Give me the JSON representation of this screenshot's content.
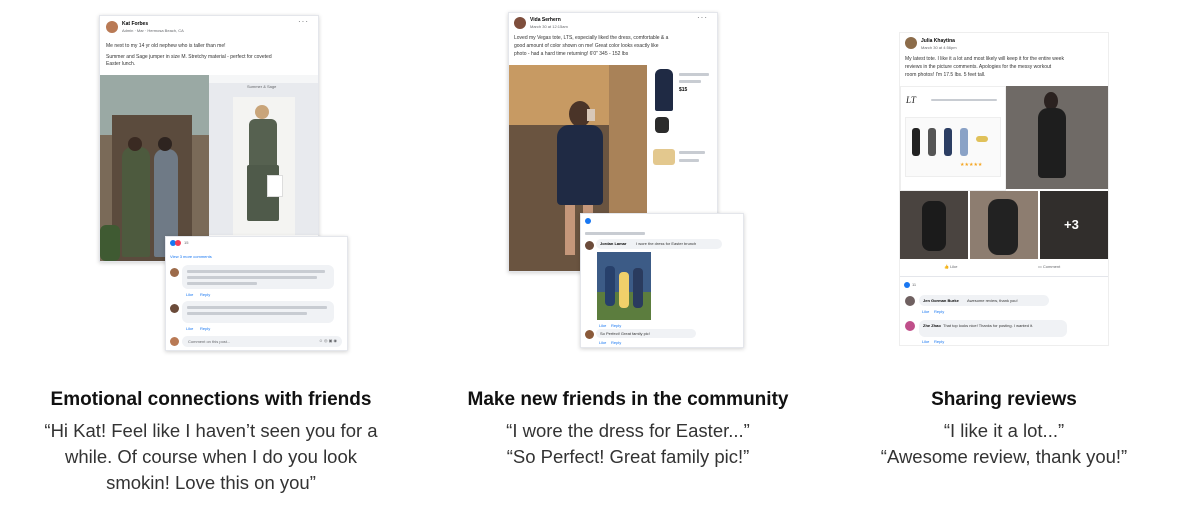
{
  "panels": [
    {
      "heading": "Emotional connections with friends",
      "quote_lines": [
        "“Hi Kat! Feel like I haven’t seen you for a",
        "while. Of course when I do you look",
        "smokin! Love this on you”"
      ],
      "post": {
        "author": "Kat Forbes",
        "meta": "Admin · Mar · Hermosa Beach, CA",
        "text_lines": [
          "Me next to my 14 yr old nephew who is taller than me!",
          "Summer and Sage jumper in size M. Stretchy material - perfect for coveted",
          "Easter lunch."
        ],
        "product_title": "Summer & Sage",
        "reaction_count": "15",
        "view_comments": "View 3 more comments",
        "comment_box_placeholder": "Comment on this post...",
        "like": "Like",
        "reply": "Reply",
        "comment_age": "1w"
      },
      "colors": {
        "avatar": "#b97a55",
        "photo_bg": "#7a6a58",
        "product_bg": "#e8eaee"
      }
    },
    {
      "heading": "Make new friends in the community",
      "quote_lines": [
        "“I wore the dress for Easter...”",
        "“So Perfect! Great family pic!”"
      ],
      "post": {
        "author": "Vida Serhern",
        "meta": "March 30 at 12:15am",
        "text_lines": [
          "Loved my Vegas tote, LTS, especially liked the dress, comfortable & a",
          "good amount of color shown on me! Great color looks exactly like",
          "photo - had a hard time returning! 6'0\" 345 - 152 lbs"
        ],
        "price": "$15",
        "comment1_author": "Jordan Lamar",
        "comment1": "I wore the dress for Easter brunch",
        "comment2": "So Perfect! Great family pic!",
        "like": "Like",
        "reply": "Reply"
      },
      "colors": {
        "avatar": "#7e4e3c",
        "photo_bg": "#8a6a48",
        "dress": "#1f2a44"
      }
    },
    {
      "heading": "Sharing reviews",
      "quote_lines": [
        "“I like it a lot...”",
        "“Awesome review, thank you!”"
      ],
      "post": {
        "author": "Julia Khaytina",
        "meta": "March 30 at 4:56pm",
        "text_lines": [
          "My latest tote. I like it a lot and most likely will keep it for the entire week",
          "reviews in the picture comments. Apologies for the messy workout",
          "room photos! I'm 17.5 lbs. 5 feet tall."
        ],
        "logo": "LT",
        "more_photos": "+3",
        "like_button": "Like",
        "comment_button": "Comment",
        "reaction_count": "11",
        "comment1_author": "Jen Gorman Burke",
        "comment1": "Awesome review, thank you!",
        "comment2_author": "Zhe Zhao",
        "comment2": "That top looks nice! Thanks for posting. I wanted it.",
        "like": "Like",
        "reply": "Reply",
        "comment_age": "1w"
      },
      "colors": {
        "avatar": "#8c6c4a",
        "photo_bg": "#3b3a3a",
        "brand": "#1877f2"
      }
    }
  ]
}
